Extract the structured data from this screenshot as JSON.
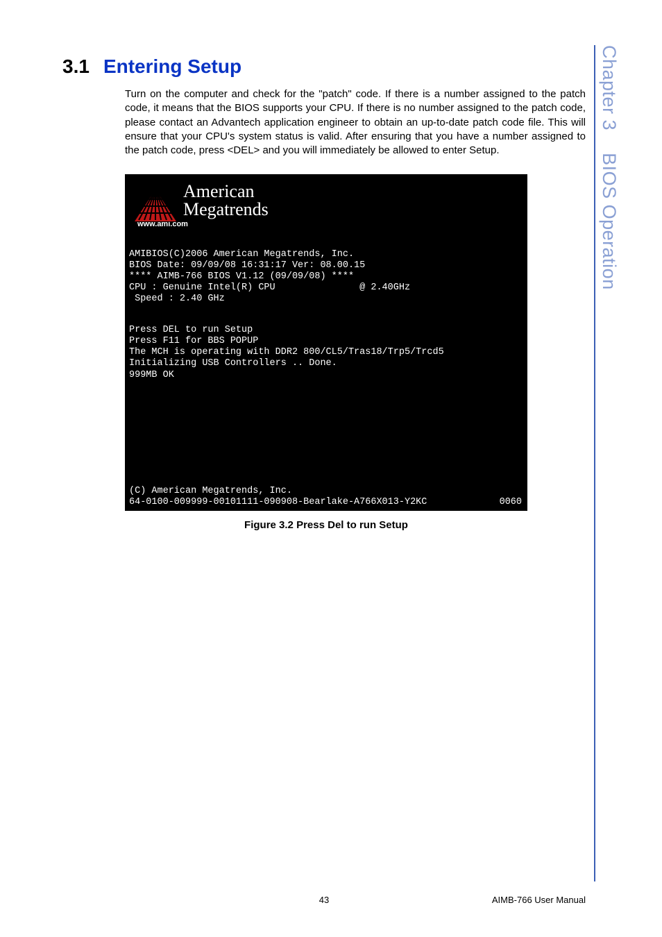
{
  "side_tab": {
    "chapter": "Chapter 3",
    "topic": "BIOS Operation"
  },
  "heading": {
    "number": "3.1",
    "title": "Entering Setup"
  },
  "paragraph": "Turn on the computer and check for the \"patch\" code. If there is a number assigned to the patch code, it means that the BIOS supports your CPU. If there is no number assigned to the patch code, please contact an Advantech application engineer to obtain an up-to-date patch code file. This will ensure that your CPU's system status is valid. After ensuring that you have a number assigned to the patch code, press <DEL> and you will immediately be allowed to enter Setup.",
  "bios": {
    "logo": {
      "line1": "American",
      "line2": "Megatrends",
      "url": "www.ami.com"
    },
    "block1": [
      "AMIBIOS(C)2006 American Megatrends, Inc.",
      "BIOS Date: 09/09/08 16:31:17 Ver: 08.00.15",
      "**** AIMB-766 BIOS V1.12 (09/09/08) ****",
      "CPU : Genuine Intel(R) CPU               @ 2.40GHz",
      " Speed : 2.40 GHz"
    ],
    "block2": [
      "Press DEL to run Setup",
      "Press F11 for BBS POPUP",
      "The MCH is operating with DDR2 800/CL5/Tras18/Trp5/Trcd5",
      "Initializing USB Controllers .. Done.",
      "999MB OK"
    ],
    "footer": [
      "(C) American Megatrends, Inc.",
      "64-0100-009999-00101111-090908-Bearlake-A766X013-Y2KC"
    ],
    "code_right": "0060"
  },
  "figure_caption": "Figure 3.2 Press Del to run Setup",
  "footer": {
    "page_number": "43",
    "doc_title": "AIMB-766 User Manual"
  }
}
